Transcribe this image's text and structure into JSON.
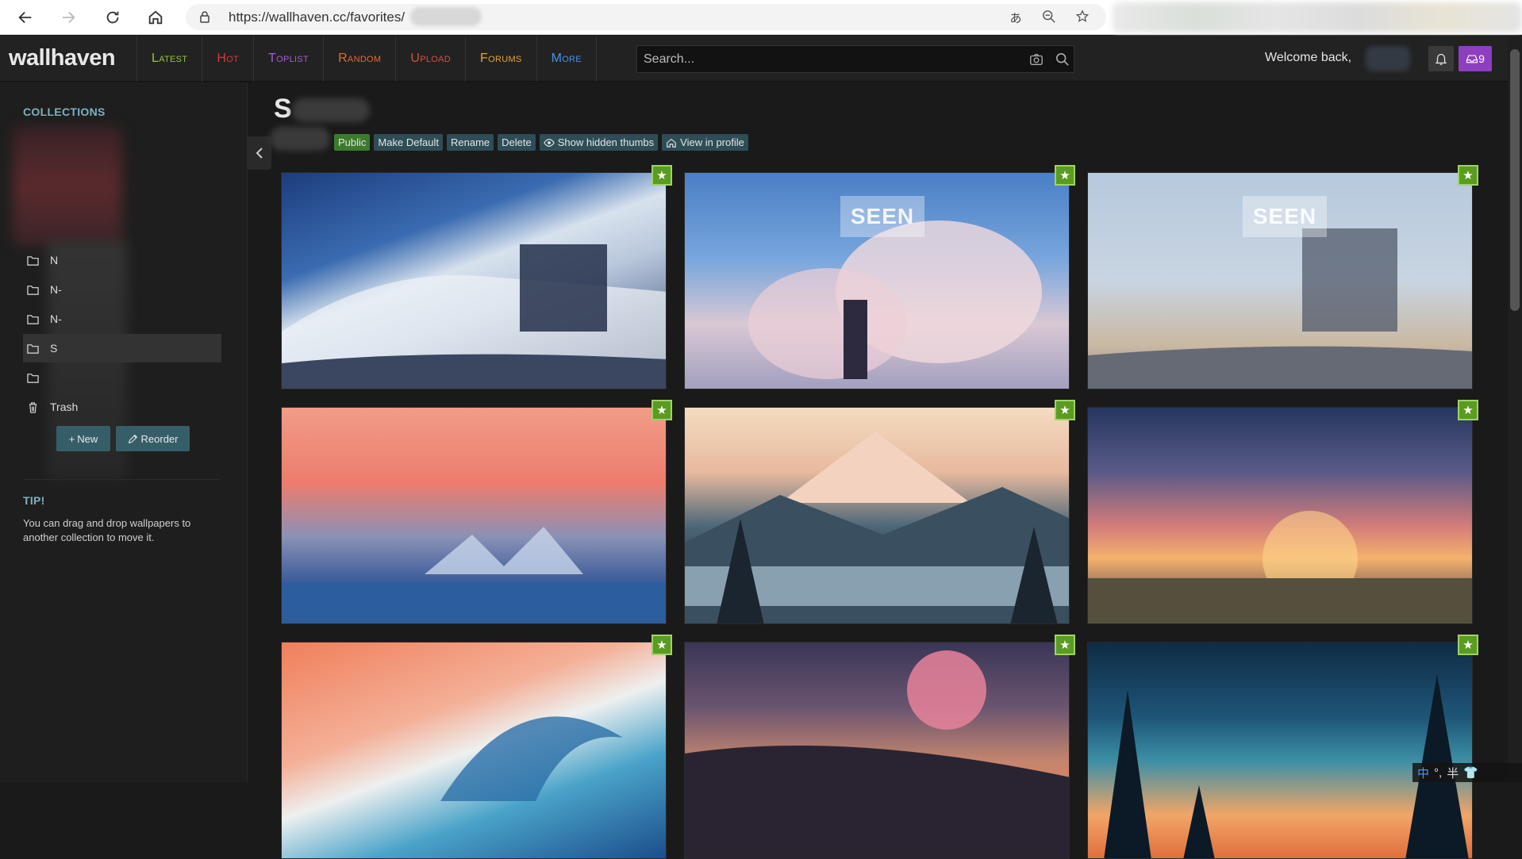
{
  "browser": {
    "url": "https://wallhaven.cc/favorites/",
    "icons": [
      "back-arrow-icon",
      "forward-arrow-icon",
      "reload-icon",
      "home-icon",
      "lock-icon",
      "translate-icon",
      "zoom-icon",
      "favorite-add-icon"
    ]
  },
  "header": {
    "logo": "wallhaven",
    "menu": [
      {
        "label": "Latest",
        "color": "#97c43b"
      },
      {
        "label": "Hot",
        "color": "#d13b3b"
      },
      {
        "label": "Toplist",
        "color": "#a85bd3"
      },
      {
        "label": "Random",
        "color": "#e06a38"
      },
      {
        "label": "Upload",
        "color": "#d34f43"
      },
      {
        "label": "Forums",
        "color": "#e4a43b"
      },
      {
        "label": "More",
        "color": "#4a8ee8"
      }
    ],
    "search_placeholder": "Search...",
    "welcome": "Welcome back,",
    "notification_count": "9"
  },
  "sidebar": {
    "collections_heading": "COLLECTIONS",
    "collections": [
      {
        "label": "N"
      },
      {
        "label": "N-"
      },
      {
        "label": "N-"
      },
      {
        "label": "S",
        "active": true
      },
      {
        "label": ""
      }
    ],
    "trash_label": "Trash",
    "new_button": "New",
    "reorder_button": "Reorder",
    "tip_heading": "TIP!",
    "tip_text": "You can drag and drop wallpapers to another collection to move it."
  },
  "main": {
    "title": "S",
    "actions": {
      "public": "Public",
      "make_default": "Make Default",
      "rename": "Rename",
      "delete": "Delete",
      "show_hidden": "Show hidden thumbs",
      "view_profile": "View in profile"
    },
    "seen_label": "SEEN",
    "favorite_icon": "star-icon"
  },
  "ime": {
    "lang": "中",
    "punct": "°,",
    "width": "半"
  }
}
